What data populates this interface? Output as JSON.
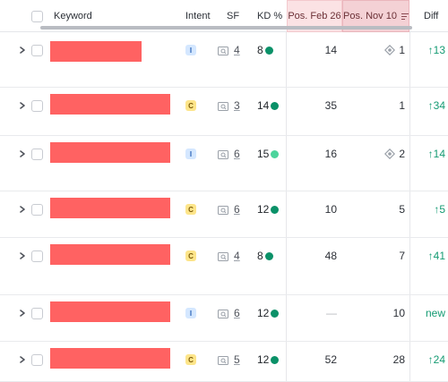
{
  "header": {
    "keyword": "Keyword",
    "intent": "Intent",
    "sf": "SF",
    "kd": "KD %",
    "pos_feb": "Pos. Feb 26",
    "pos_nov": "Pos. Nov 10",
    "diff": "Diff"
  },
  "colors": {
    "redacted": "#ff6262",
    "kd_green": "#0a9168",
    "kd_light_green": "#4cd49c",
    "diff_green": "#159b73",
    "highlight_feb": "#fbe2e4",
    "highlight_nov": "#f4d1d5"
  },
  "rows": [
    {
      "intent": "I",
      "sf": "4",
      "kd": "8",
      "kd_color": "#0a9168",
      "pos_feb": "14",
      "pos_nov": "1",
      "nov_feature": "serp-feature-diamond-icon",
      "diff": "↑13"
    },
    {
      "intent": "C",
      "sf": "3",
      "kd": "14",
      "kd_color": "#0a9168",
      "pos_feb": "35",
      "pos_nov": "1",
      "diff": "↑34"
    },
    {
      "intent": "I",
      "sf": "6",
      "kd": "15",
      "kd_color": "#4cd49c",
      "pos_feb": "16",
      "pos_nov": "2",
      "nov_feature": "serp-feature-diamond-icon",
      "diff": "↑14"
    },
    {
      "intent": "C",
      "sf": "6",
      "kd": "12",
      "kd_color": "#0a9168",
      "pos_feb": "10",
      "pos_nov": "5",
      "diff": "↑5"
    },
    {
      "intent": "C",
      "sf": "4",
      "kd": "8",
      "kd_color": "#0a9168",
      "pos_feb": "48",
      "pos_nov": "7",
      "diff": "↑41"
    },
    {
      "intent": "I",
      "sf": "6",
      "kd": "12",
      "kd_color": "#0a9168",
      "pos_feb": "—",
      "pos_nov": "10",
      "diff": "new"
    },
    {
      "intent": "C",
      "sf": "5",
      "kd": "12",
      "kd_color": "#0a9168",
      "pos_feb": "52",
      "pos_nov": "28",
      "diff": "↑24"
    }
  ]
}
